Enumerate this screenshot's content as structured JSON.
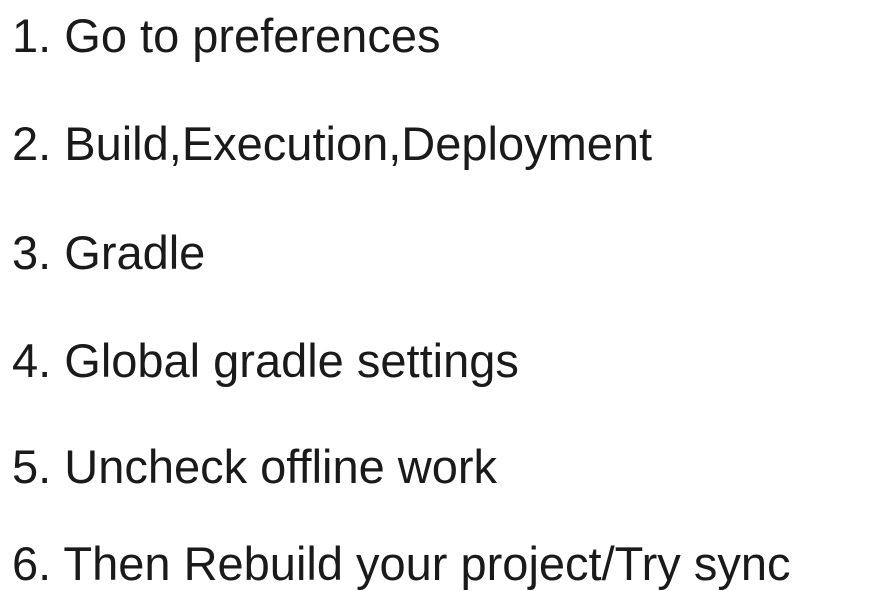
{
  "steps": [
    "1. Go to preferences",
    "2. Build,Execution,Deployment",
    "3. Gradle",
    "4. Global gradle settings",
    "5. Uncheck offline work",
    "6. Then Rebuild your project/Try sync"
  ]
}
